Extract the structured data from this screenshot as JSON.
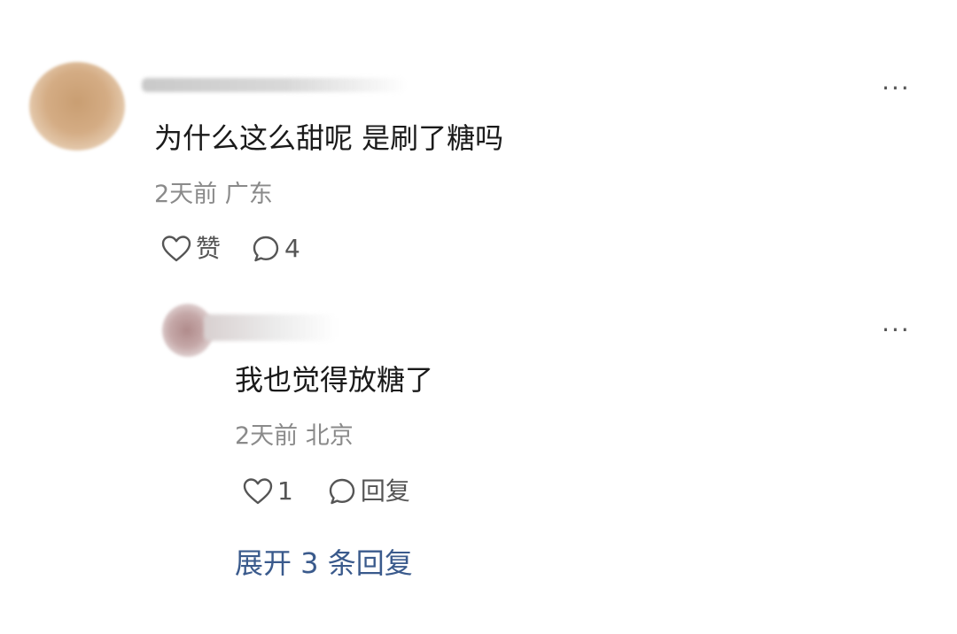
{
  "comment": {
    "text": "为什么这么甜呢 是刷了糖吗",
    "meta": "2天前 广东",
    "like_label": "赞",
    "reply_count": "4",
    "more_label": "..."
  },
  "reply": {
    "text": "我也觉得放糖了",
    "meta": "2天前 北京",
    "like_count": "1",
    "reply_label": "回复",
    "more_label": "..."
  },
  "expand_label": "展开 3 条回复",
  "colors": {
    "link": "#3a5a8c",
    "meta": "#8a8a8a",
    "icon": "#555555"
  }
}
